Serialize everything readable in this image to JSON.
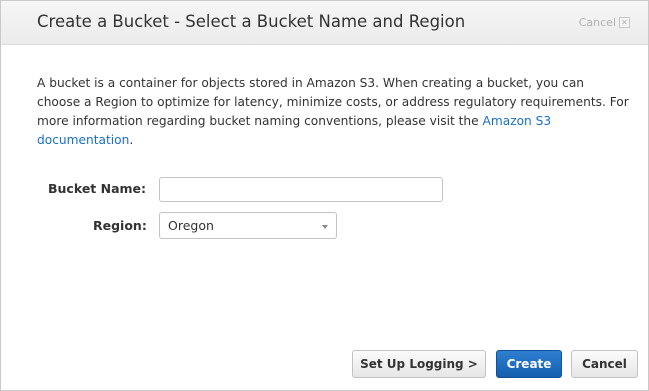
{
  "dialog": {
    "title": "Create a Bucket - Select a Bucket Name and Region",
    "cancel_label": "Cancel",
    "cancel_icon": "close-icon"
  },
  "description": {
    "text": "A bucket is a container for objects stored in Amazon S3. When creating a bucket, you can choose a Region to optimize for latency, minimize costs, or address regulatory requirements. For more information regarding bucket naming conventions, please visit the ",
    "link_text": "Amazon S3 documentation",
    "suffix": "."
  },
  "form": {
    "bucket_name_label": "Bucket Name:",
    "bucket_name_value": "",
    "region_label": "Region:",
    "region_value": "Oregon"
  },
  "buttons": {
    "logging": "Set Up Logging >",
    "create": "Create",
    "cancel": "Cancel"
  },
  "colors": {
    "primary_button": "#1a66b8",
    "link": "#1a6fc4"
  }
}
